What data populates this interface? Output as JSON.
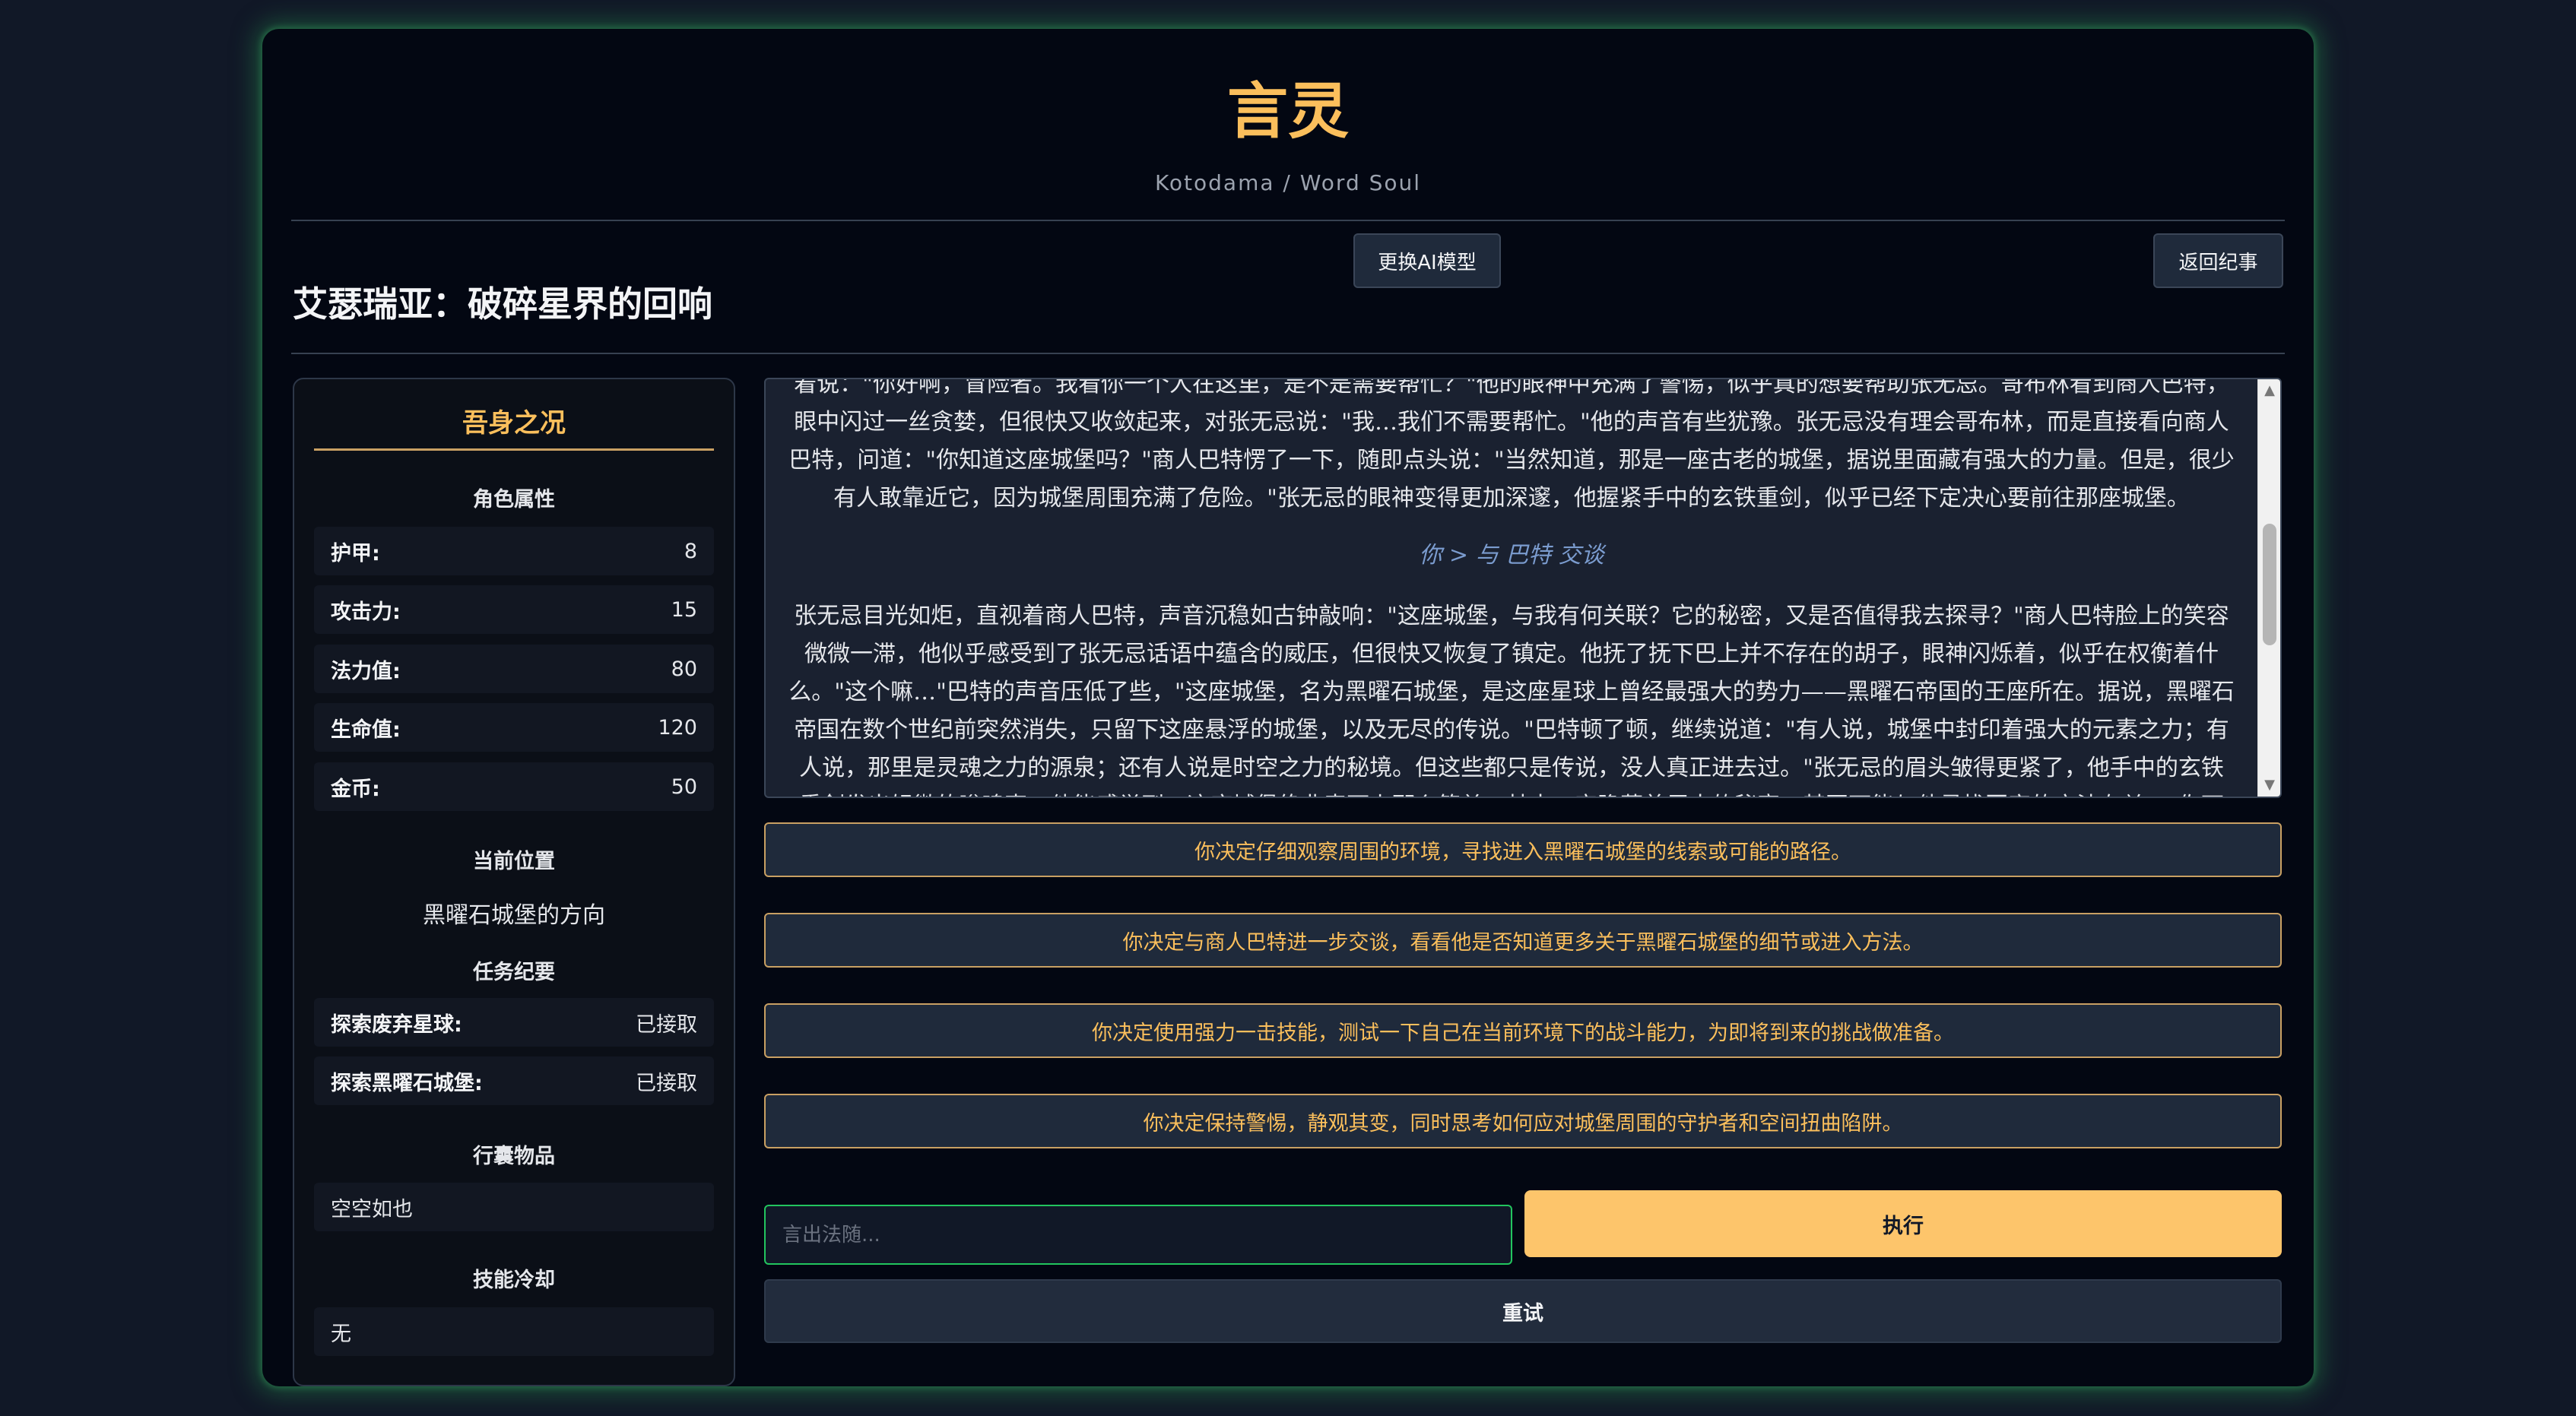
{
  "app": {
    "title": "言灵",
    "subtitle": "Kotodama / Word Soul"
  },
  "header": {
    "story_title": "艾瑟瑞亚：破碎星界的回响",
    "change_model_label": "更换AI模型",
    "back_label": "返回纪事"
  },
  "status": {
    "panel_title": "吾身之况",
    "attributes_label": "角色属性",
    "attributes": [
      {
        "key": "护甲:",
        "value": "8"
      },
      {
        "key": "攻击力:",
        "value": "15"
      },
      {
        "key": "法力值:",
        "value": "80"
      },
      {
        "key": "生命值:",
        "value": "120"
      },
      {
        "key": "金币:",
        "value": "50"
      }
    ],
    "location_label": "当前位置",
    "location": "黑曜石城堡的方向",
    "quests_label": "任务纪要",
    "quests": [
      {
        "key": "探索废弃星球:",
        "value": "已接取"
      },
      {
        "key": "探索黑曜石城堡:",
        "value": "已接取"
      }
    ],
    "inventory_label": "行囊物品",
    "inventory": "空空如也",
    "cooldown_label": "技能冷却",
    "cooldown": "无"
  },
  "story": {
    "paragraph1": "着说：\"你好啊，冒险者。我看你一个人在这里，是不是需要帮忙？\"他的眼神中充满了警惕，似乎真的想要帮助张无忌。哥布林看到商人巴特，眼中闪过一丝贪婪，但很快又收敛起来，对张无忌说：\"我…我们不需要帮忙。\"他的声音有些犹豫。张无忌没有理会哥布林，而是直接看向商人巴特，问道：\"你知道这座城堡吗？\"商人巴特愣了一下，随即点头说：\"当然知道，那是一座古老的城堡，据说里面藏有强大的力量。但是，很少有人敢靠近它，因为城堡周围充满了危险。\"张无忌的眼神变得更加深邃，他握紧手中的玄铁重剑，似乎已经下定决心要前往那座城堡。",
    "action": "你 > 与 巴特 交谈",
    "paragraph2": "张无忌目光如炬，直视着商人巴特，声音沉稳如古钟敲响：\"这座城堡，与我有何关联？它的秘密，又是否值得我去探寻？\"商人巴特脸上的笑容微微一滞，他似乎感受到了张无忌话语中蕴含的威压，但很快又恢复了镇定。他抚了抚下巴上并不存在的胡子，眼神闪烁着，似乎在权衡着什么。\"这个嘛…\"巴特的声音压低了些，\"这座城堡，名为黑曜石城堡，是这座星球上曾经最强大的势力——黑曜石帝国的王座所在。据说，黑曜石帝国在数个世纪前突然消失，只留下这座悬浮的城堡，以及无尽的传说。\"巴特顿了顿，继续说道：\"有人说，城堡中封印着强大的元素之力；有人说，那里是灵魂之力的源泉；还有人说是时空之力的秘境。但这些都只是传说，没人真正进去过。\"张无忌的眉头皱得更紧了，他手中的玄铁重剑发出轻微的嗡鸣声，他能感觉到，这座城堡绝非表面上那么简单，其中一定隐藏着巨大的秘密，甚至可能与他寻找回家的方法有关。\"你可知如"
  },
  "choices": [
    "你决定仔细观察周围的环境，寻找进入黑曜石城堡的线索或可能的路径。",
    "你决定与商人巴特进一步交谈，看看他是否知道更多关于黑曜石城堡的细节或进入方法。",
    "你决定使用强力一击技能，测试一下自己在当前环境下的战斗能力，为即将到来的挑战做准备。",
    "你决定保持警惕，静观其变，同时思考如何应对城堡周围的守护者和空间扭曲陷阱。"
  ],
  "command": {
    "placeholder": "言出法随...",
    "value": "",
    "execute_label": "执行",
    "retry_label": "重试"
  },
  "colors": {
    "accent_gold": "#fbbf5c",
    "execute_button": "#fdc56b",
    "input_focus_border": "#22c55e",
    "glow": "#2b8a52"
  }
}
